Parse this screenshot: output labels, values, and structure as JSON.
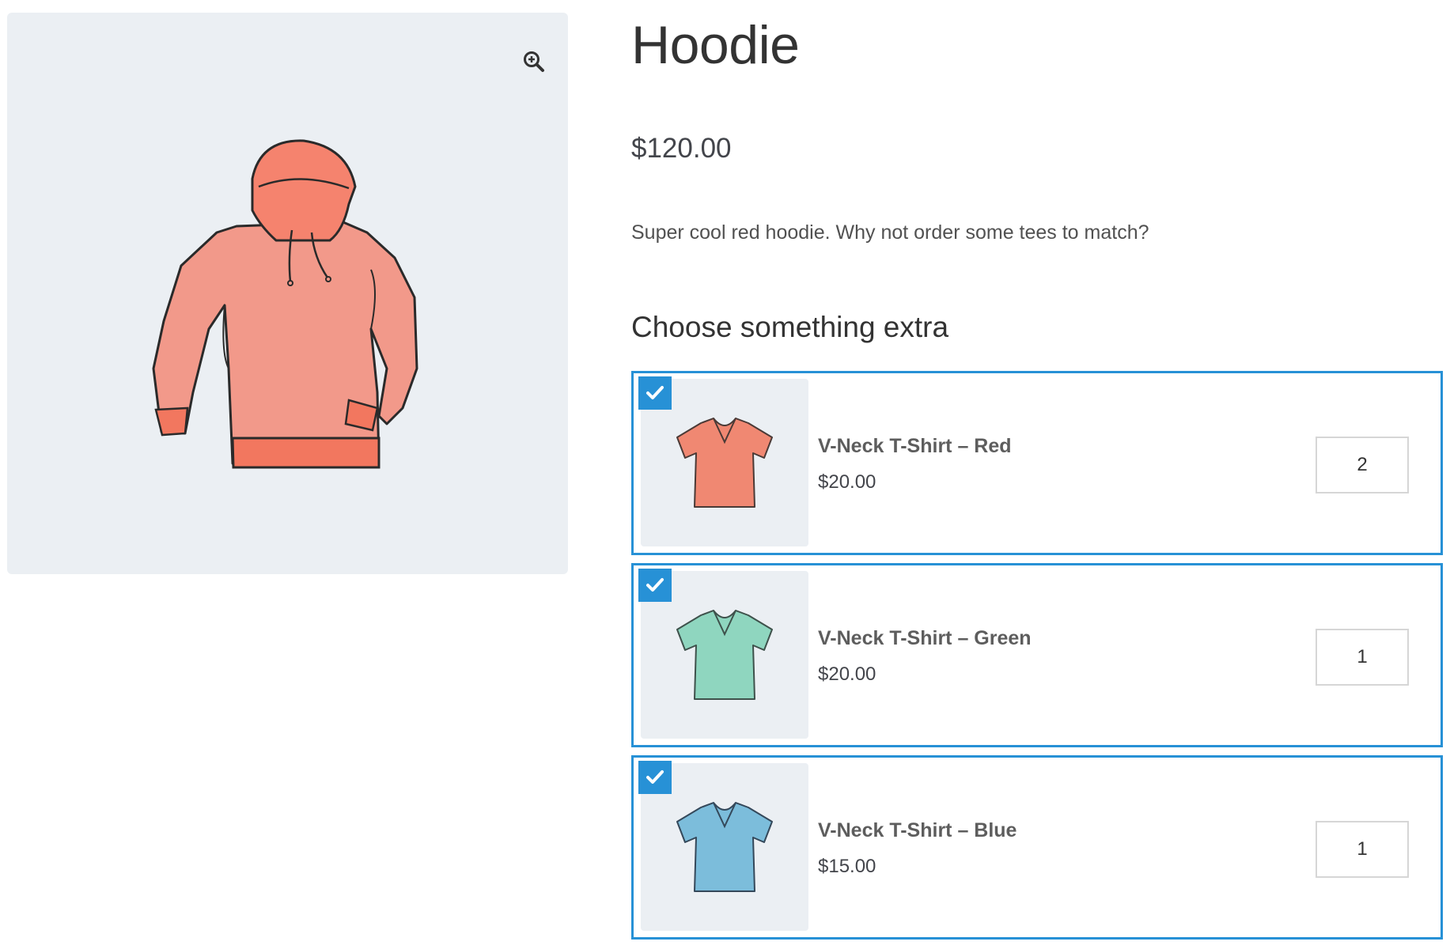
{
  "product": {
    "title": "Hoodie",
    "price": "$120.00",
    "description": "Super cool red hoodie. Why not order some tees to match?"
  },
  "gallery": {
    "zoom_icon": "zoom-in-icon",
    "image_icon": "hoodie-image"
  },
  "extras": {
    "heading": "Choose something extra",
    "items": [
      {
        "name": "V-Neck T-Shirt – Red",
        "price": "$20.00",
        "quantity": "2",
        "checked": true,
        "color": "#f08872"
      },
      {
        "name": "V-Neck T-Shirt – Green",
        "price": "$20.00",
        "quantity": "1",
        "checked": true,
        "color": "#8fd6bf"
      },
      {
        "name": "V-Neck T-Shirt – Blue",
        "price": "$15.00",
        "quantity": "1",
        "checked": true,
        "color": "#7cbddb"
      }
    ]
  },
  "colors": {
    "accent": "#2791d6",
    "image_background": "#ebeff3",
    "hoodie": "#f2998a"
  }
}
